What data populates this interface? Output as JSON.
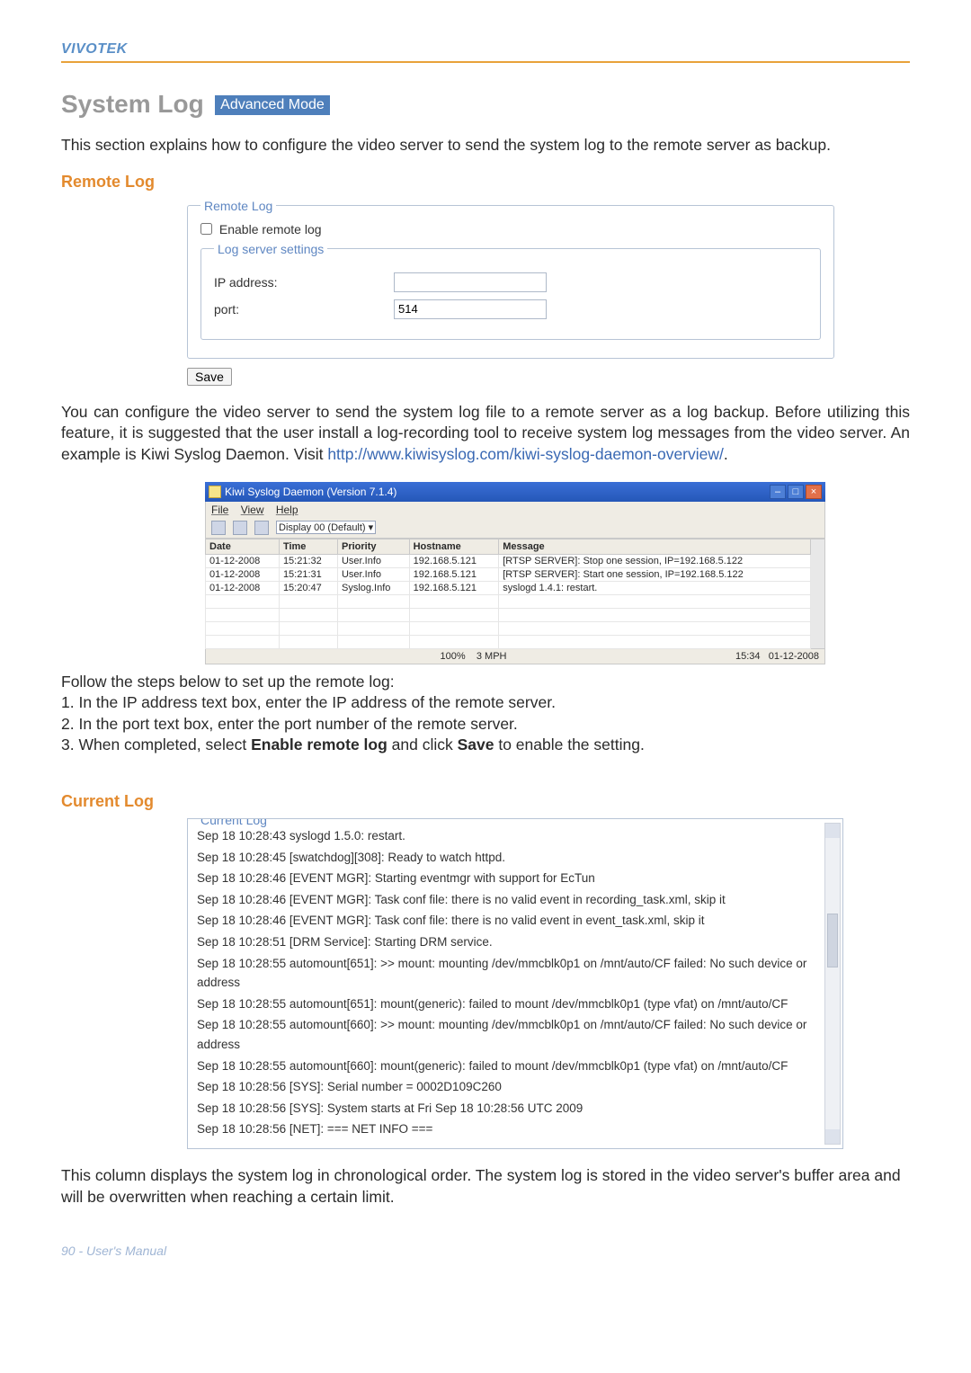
{
  "brand": "VIVOTEK",
  "title": "System Log",
  "adv_mode": "Advanced Mode",
  "intro": "This section explains how to configure the video server to send the system log to the remote server as backup.",
  "remote_log": {
    "heading": "Remote Log",
    "fieldset_legend": "Remote Log",
    "enable_label": "Enable remote log",
    "settings_legend": "Log server settings",
    "ip_label": "IP address:",
    "ip_value": "",
    "port_label": "port:",
    "port_value": "514",
    "save_btn": "Save"
  },
  "para2_part1": "You can configure the video server to send the system log file to a remote server as a log backup. Before utilizing this feature, it is suggested that the user install a log-recording tool to receive system log messages from the video server. An example is Kiwi Syslog Daemon. Visit ",
  "para2_link": "http://www.kiwisyslog.com/kiwi-syslog-daemon-overview/",
  "para2_part2": ".",
  "kiwi": {
    "title": "Kiwi Syslog Daemon (Version 7.1.4)",
    "menu": {
      "file": "File",
      "view": "View",
      "help": "Help"
    },
    "display_label": "Display 00 (Default)",
    "columns": [
      "Date",
      "Time",
      "Priority",
      "Hostname",
      "Message"
    ],
    "rows": [
      {
        "date": "01-12-2008",
        "time": "15:21:32",
        "priority": "User.Info",
        "hostname": "192.168.5.121",
        "message": "[RTSP SERVER]: Stop one session, IP=192.168.5.122"
      },
      {
        "date": "01-12-2008",
        "time": "15:21:31",
        "priority": "User.Info",
        "hostname": "192.168.5.121",
        "message": "[RTSP SERVER]: Start one session, IP=192.168.5.122"
      },
      {
        "date": "01-12-2008",
        "time": "15:20:47",
        "priority": "Syslog.Info",
        "hostname": "192.168.5.121",
        "message": "syslogd 1.4.1: restart."
      }
    ],
    "status_left": "100%",
    "status_mid": "3 MPH",
    "status_time": "15:34",
    "status_date": "01-12-2008"
  },
  "steps": {
    "intro": "Follow the steps below to set up the remote log:",
    "s1": "1. In the IP address text box, enter the IP address of the remote server.",
    "s2": "2. In the port text box, enter the port number of the remote server.",
    "s3a": "3. When completed, select ",
    "s3b": "Enable remote log",
    "s3c": " and click ",
    "s3d": "Save",
    "s3e": " to enable the setting."
  },
  "current_log": {
    "heading": "Current Log",
    "legend": "Current Log",
    "lines": [
      "Sep 18 10:28:43 syslogd 1.5.0: restart.",
      "Sep 18 10:28:45 [swatchdog][308]: Ready to watch httpd.",
      "Sep 18 10:28:46 [EVENT MGR]: Starting eventmgr with support for EcTun",
      "Sep 18 10:28:46 [EVENT MGR]: Task conf file: there is no valid event in recording_task.xml, skip it",
      "Sep 18 10:28:46 [EVENT MGR]: Task conf file: there is no valid event in event_task.xml, skip it",
      "Sep 18 10:28:51 [DRM Service]: Starting DRM service.",
      "Sep 18 10:28:55 automount[651]: >> mount: mounting /dev/mmcblk0p1 on /mnt/auto/CF failed: No such device or address",
      "Sep 18 10:28:55 automount[651]: mount(generic): failed to mount /dev/mmcblk0p1 (type vfat) on /mnt/auto/CF",
      "Sep 18 10:28:55 automount[660]: >> mount: mounting /dev/mmcblk0p1 on /mnt/auto/CF failed: No such device or address",
      "Sep 18 10:28:55 automount[660]: mount(generic): failed to mount /dev/mmcblk0p1 (type vfat) on /mnt/auto/CF",
      "Sep 18 10:28:56 [SYS]: Serial number = 0002D109C260",
      "Sep 18 10:28:56 [SYS]: System starts at Fri Sep 18 10:28:56 UTC 2009",
      "Sep 18 10:28:56 [NET]: === NET INFO ==="
    ]
  },
  "closing": "This column displays the system log in chronological order. The system log is stored in the video server's buffer area and will be overwritten when reaching a certain limit.",
  "footer": "90 - User's Manual"
}
